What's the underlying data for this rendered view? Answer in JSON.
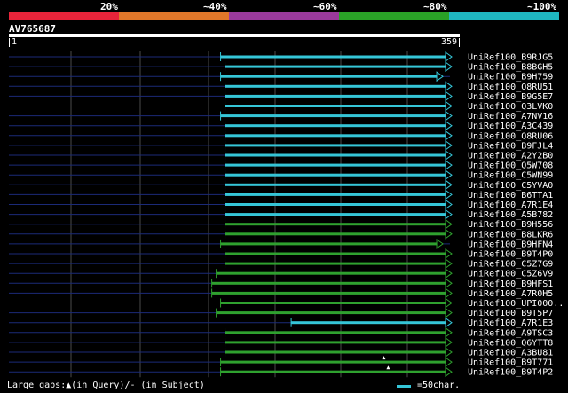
{
  "legend": {
    "colors": [
      "#e8243a",
      "#e0772a",
      "#9a3a9c",
      "#2aa227",
      "#1fb7c0"
    ],
    "labels": [
      "20%",
      "~40%",
      "~60%",
      "~80%",
      "~100%"
    ]
  },
  "query": {
    "name": "AV765687",
    "start": "1",
    "end": "359"
  },
  "colors": {
    "cyan": "#35c6d8",
    "green": "#2fa12f",
    "grid": "#4a4a4a",
    "row_line": "#1b2a78"
  },
  "hits": [
    {
      "id": "UniRef100_B9RJG5",
      "from": 0.48,
      "to": 1.0,
      "color": "cyan"
    },
    {
      "id": "UniRef100_B8BGH5",
      "from": 0.49,
      "to": 1.0,
      "color": "cyan"
    },
    {
      "id": "UniRef100_B9H759",
      "from": 0.48,
      "to": 0.98,
      "color": "cyan"
    },
    {
      "id": "UniRef100_Q8RU51",
      "from": 0.49,
      "to": 1.0,
      "color": "cyan"
    },
    {
      "id": "UniRef100_B9G5E7",
      "from": 0.49,
      "to": 1.0,
      "color": "cyan"
    },
    {
      "id": "UniRef100_Q3LVK0",
      "from": 0.49,
      "to": 1.0,
      "color": "cyan"
    },
    {
      "id": "UniRef100_A7NV16",
      "from": 0.48,
      "to": 1.0,
      "color": "cyan"
    },
    {
      "id": "UniRef100_A3C439",
      "from": 0.49,
      "to": 1.0,
      "color": "cyan"
    },
    {
      "id": "UniRef100_Q8RU06",
      "from": 0.49,
      "to": 1.0,
      "color": "cyan"
    },
    {
      "id": "UniRef100_B9FJL4",
      "from": 0.49,
      "to": 1.0,
      "color": "cyan"
    },
    {
      "id": "UniRef100_A2Y2B0",
      "from": 0.49,
      "to": 1.0,
      "color": "cyan"
    },
    {
      "id": "UniRef100_Q5W708",
      "from": 0.49,
      "to": 1.0,
      "color": "cyan"
    },
    {
      "id": "UniRef100_C5WN99",
      "from": 0.49,
      "to": 1.0,
      "color": "cyan"
    },
    {
      "id": "UniRef100_C5YVA0",
      "from": 0.49,
      "to": 1.0,
      "color": "cyan"
    },
    {
      "id": "UniRef100_B6TTA1",
      "from": 0.49,
      "to": 1.0,
      "color": "cyan"
    },
    {
      "id": "UniRef100_A7R1E4",
      "from": 0.49,
      "to": 1.0,
      "color": "cyan"
    },
    {
      "id": "UniRef100_A5B782",
      "from": 0.49,
      "to": 1.0,
      "color": "cyan"
    },
    {
      "id": "UniRef100_B9H556",
      "from": 0.49,
      "to": 1.0,
      "color": "green"
    },
    {
      "id": "UniRef100_B8LKR6",
      "from": 0.49,
      "to": 1.0,
      "color": "green"
    },
    {
      "id": "UniRef100_B9HFN4",
      "from": 0.48,
      "to": 0.98,
      "color": "green"
    },
    {
      "id": "UniRef100_B9T4P0",
      "from": 0.49,
      "to": 1.0,
      "color": "green"
    },
    {
      "id": "UniRef100_C5Z7G9",
      "from": 0.49,
      "to": 1.0,
      "color": "green"
    },
    {
      "id": "UniRef100_C5Z6V9",
      "from": 0.47,
      "to": 1.0,
      "color": "green"
    },
    {
      "id": "UniRef100_B9HFS1",
      "from": 0.46,
      "to": 1.0,
      "color": "green"
    },
    {
      "id": "UniRef100_A7R0H5",
      "from": 0.46,
      "to": 1.0,
      "color": "green"
    },
    {
      "id": "UniRef100_UPI000..",
      "from": 0.48,
      "to": 1.0,
      "color": "green"
    },
    {
      "id": "UniRef100_B9T5P7",
      "from": 0.47,
      "to": 1.0,
      "color": "green"
    },
    {
      "id": "UniRef100_A7R1E3",
      "from": 0.64,
      "to": 1.0,
      "color": "cyan"
    },
    {
      "id": "UniRef100_A9TSC3",
      "from": 0.49,
      "to": 1.0,
      "color": "green"
    },
    {
      "id": "UniRef100_Q6YTT8",
      "from": 0.49,
      "to": 1.0,
      "color": "green"
    },
    {
      "id": "UniRef100_A3BU81",
      "from": 0.49,
      "to": 1.0,
      "color": "green"
    },
    {
      "id": "UniRef100_B9T771",
      "from": 0.48,
      "to": 1.0,
      "color": "green",
      "gap": 0.85
    },
    {
      "id": "UniRef100_B9T4P2",
      "from": 0.48,
      "to": 1.0,
      "color": "green",
      "gap": 0.86
    }
  ],
  "footer": {
    "gaps_legend": "Large gaps:▲(in Query)/- (in Subject)",
    "scale": "=50char."
  }
}
